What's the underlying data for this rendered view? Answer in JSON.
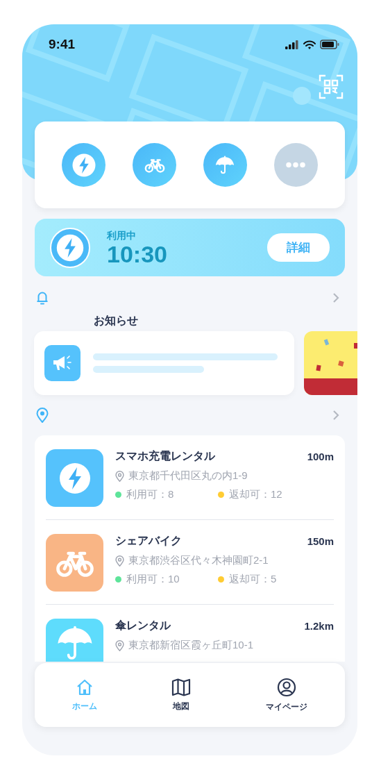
{
  "status_bar": {
    "time": "9:41"
  },
  "services": [
    {
      "kind": "charge"
    },
    {
      "kind": "bike"
    },
    {
      "kind": "umbrella"
    },
    {
      "kind": "more"
    }
  ],
  "active_rental": {
    "label": "利用中",
    "time": "10:30",
    "button": "詳細"
  },
  "notice": {
    "title": "お知らせ"
  },
  "places": [
    {
      "kind": "charge",
      "name": "スマホ充電レンタル",
      "distance": "100m",
      "address": "東京都千代田区丸の内1-9",
      "available": "利用可：8",
      "returnable": "返却可：12"
    },
    {
      "kind": "bike",
      "name": "シェアバイク",
      "distance": "150m",
      "address": "東京都渋谷区代々木神園町2-1",
      "available": "利用可：10",
      "returnable": "返却可：5"
    },
    {
      "kind": "umbrella",
      "name": "傘レンタル",
      "distance": "1.2km",
      "address": "東京都新宿区霞ヶ丘町10-1"
    }
  ],
  "tabs": [
    {
      "kind": "home",
      "label": "ホーム",
      "selected": true
    },
    {
      "kind": "map",
      "label": "地図",
      "selected": false
    },
    {
      "kind": "profile",
      "label": "マイページ",
      "selected": false
    }
  ]
}
